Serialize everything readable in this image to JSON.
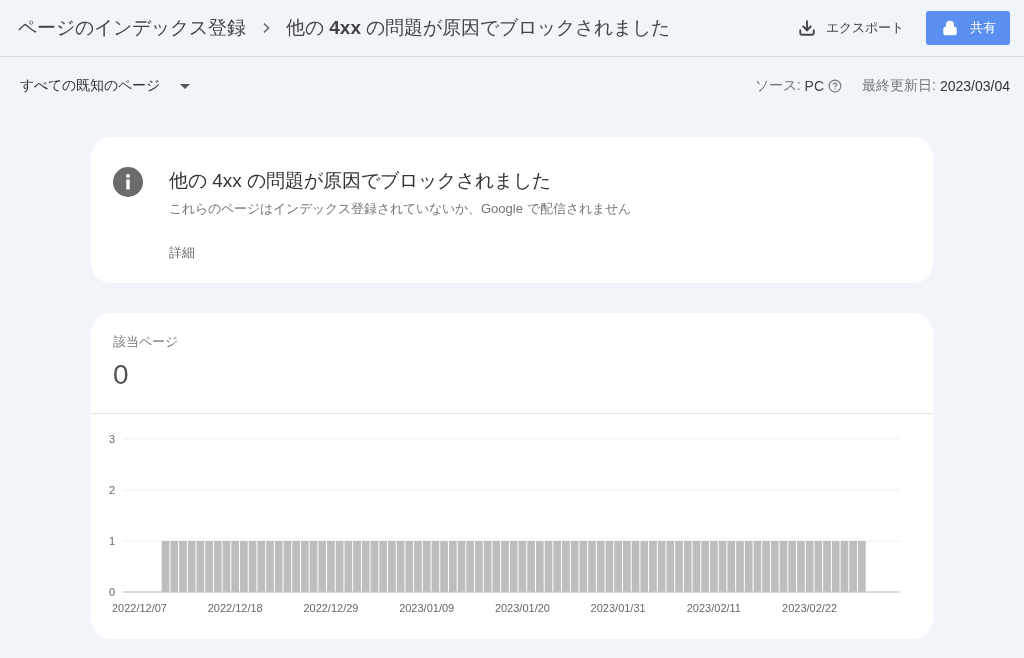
{
  "header": {
    "breadcrumb": [
      {
        "label": "ページのインデックス登録"
      },
      {
        "label": "他の **4xx** の問題が原因でブロックされました"
      }
    ],
    "export_button": {
      "label": "エクスポート"
    },
    "share_button": {
      "label": "共有"
    }
  },
  "filter_bar": {
    "dropdown": {
      "label": "すべての既知のページ"
    },
    "source_label": "ソース:",
    "source_value": "PC",
    "updated_label": "最終更新日:",
    "updated_value": "2023/03/04"
  },
  "issue_card": {
    "title": "他の 4xx の問題が原因でブロックされました",
    "description": "これらのページはインデックス登録されていないか、Google で配信されません",
    "details_link": "詳細"
  },
  "pages_card": {
    "label": "該当ページ",
    "count": "0",
    "chart_data": {
      "type": "bar",
      "ylim": [
        0,
        3
      ],
      "yticks": [
        0,
        1,
        2,
        3
      ],
      "categories": [
        null,
        null,
        null,
        "2022/12/07",
        null,
        null,
        null,
        null,
        null,
        null,
        null,
        null,
        null,
        null,
        "2022/12/18",
        null,
        null,
        null,
        null,
        null,
        null,
        null,
        null,
        null,
        null,
        "2022/12/29",
        null,
        null,
        null,
        null,
        null,
        null,
        null,
        null,
        null,
        null,
        "2023/01/09",
        null,
        null,
        null,
        null,
        null,
        null,
        null,
        null,
        null,
        null,
        "2023/01/20",
        null,
        null,
        null,
        null,
        null,
        null,
        null,
        null,
        null,
        null,
        "2023/01/31",
        null,
        null,
        null,
        null,
        null,
        null,
        null,
        null,
        null,
        null,
        "2023/02/11",
        null,
        null,
        null,
        null,
        null,
        null,
        null,
        null,
        null,
        null,
        "2023/02/22",
        null,
        null,
        null,
        null,
        null,
        null,
        null,
        null,
        null,
        null
      ],
      "values": [
        0,
        0,
        0,
        0,
        0,
        0,
        1,
        1,
        1,
        1,
        1,
        1,
        1,
        1,
        1,
        1,
        1,
        1,
        1,
        1,
        1,
        1,
        1,
        1,
        1,
        1,
        1,
        1,
        1,
        1,
        1,
        1,
        1,
        1,
        1,
        1,
        1,
        1,
        1,
        1,
        1,
        1,
        1,
        1,
        1,
        1,
        1,
        1,
        1,
        1,
        1,
        1,
        1,
        1,
        1,
        1,
        1,
        1,
        1,
        1,
        1,
        1,
        1,
        1,
        1,
        1,
        1,
        1,
        1,
        1,
        1,
        1,
        1,
        1,
        1,
        1,
        1,
        1,
        1,
        1,
        1,
        1,
        1,
        1,
        1,
        1,
        1,
        0,
        0,
        0,
        0
      ]
    }
  }
}
